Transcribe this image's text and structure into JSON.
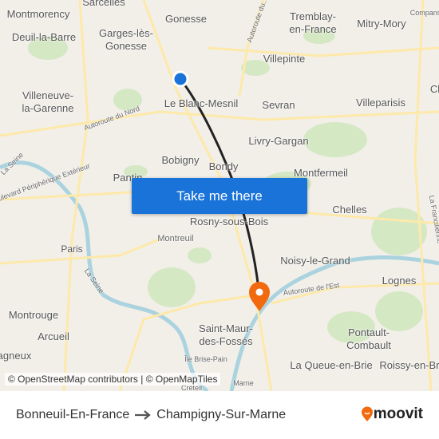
{
  "map": {
    "labels": [
      "Sarcelles",
      "Gonesse",
      "Montmorency",
      "Deuil-la-Barre",
      "Garges-lès-\nGonesse",
      "Tremblay-\nen-France",
      "Mitry-Mory",
      "Villepinte",
      "Villeneuve-\nla-Garenne",
      "Le Blanc-Mesnil",
      "Sevran",
      "Villeparisis",
      "Livry-Gargan",
      "Bobigny",
      "Bondy",
      "Montfermeil",
      "Pantin",
      "Rosny-sous-Bois",
      "Chelles",
      "Montreuil",
      "Paris",
      "Noisy-le-Grand",
      "Lognes",
      "Montrouge",
      "Saint-Maur-\ndes-Fossés",
      "Pontault-\nCombault",
      "Arcueil",
      "La Queue-en-Brie",
      "Roissy-en-Brie",
      "Autoroute du Nord",
      "Boulevard Périphérique Extérieur",
      "La Seine",
      "La Seine",
      "Autoroute de l'Est",
      "Autoroute du...",
      "Compans",
      "Île Brise-Pain",
      "Créteil",
      "Marne",
      "La Francilienne",
      "Cl",
      "agneux"
    ],
    "origin_marker_color": "#1a73d9",
    "destination_marker_color": "#f26a0f",
    "route_color": "#222222",
    "attribution": "© OpenStreetMap contributors | © OpenMapTiles"
  },
  "cta": {
    "label": "Take me there",
    "color": "#1a73d9"
  },
  "footer": {
    "origin": "Bonneuil-En-France",
    "arrow_icon": "arrow-right-icon",
    "destination": "Champigny-Sur-Marne",
    "logo_text": "moovit",
    "logo_color": "#f26a0f"
  }
}
